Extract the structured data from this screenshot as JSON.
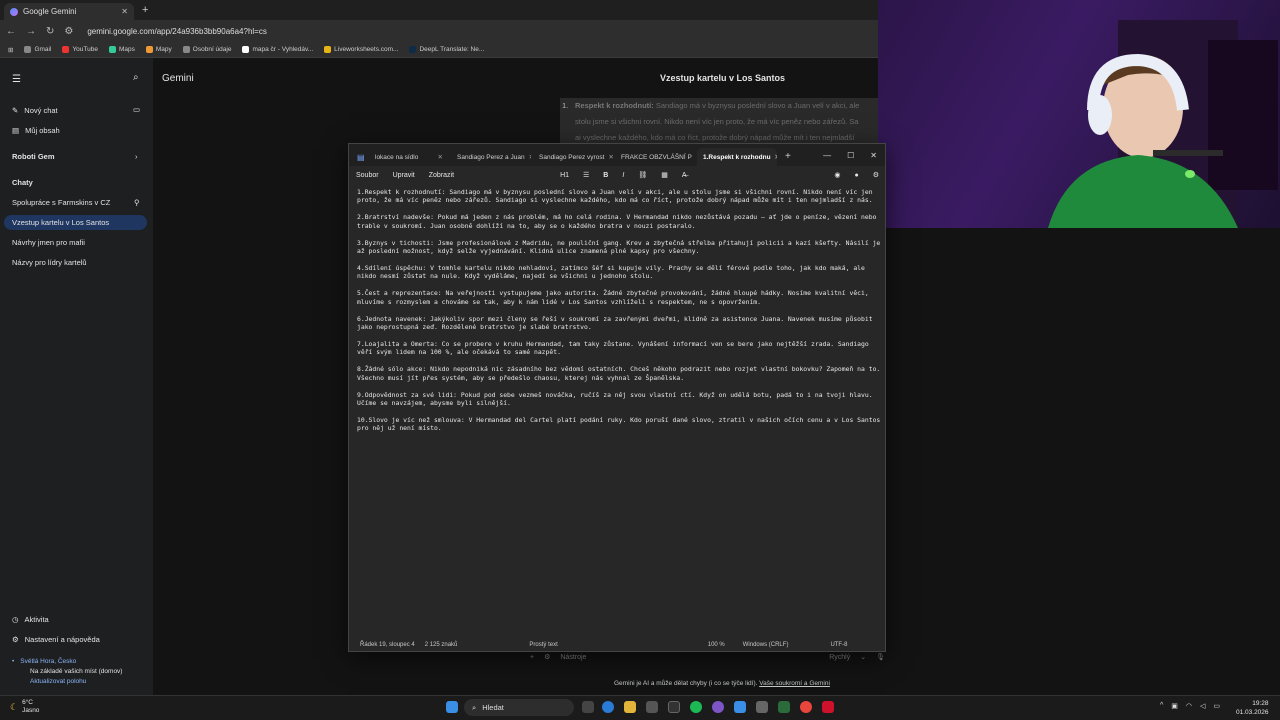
{
  "browser": {
    "tab_title": "Google Gemini",
    "tab_close": "✕",
    "new_tab": "+",
    "url": "gemini.google.com/app/24a936b3bb90a6a4?hl=cs",
    "bookmarks": [
      "Gmail",
      "YouTube",
      "Maps",
      "Mapy",
      "Osobní údaje",
      "mapa čr - Vyhledáv...",
      "Liveworksheets.com...",
      "DeepL Translate: Ne..."
    ]
  },
  "gemini": {
    "logo": "Gemini",
    "new_chat": "Nový chat",
    "my_content": "Můj obsah",
    "robots": "Roboti Gem",
    "chats_heading": "Chaty",
    "chats": [
      "Spolupráce s Farmskins v CZ",
      "Vzestup kartelu v Los Santos",
      "Návrhy jmen pro mafii",
      "Názvy pro lídry kartelů"
    ],
    "activity": "Aktivita",
    "settings": "Nastavení a nápověda",
    "location_name": "Světlá Hora, Česko",
    "location_basis": "Na základě vašich míst (domov)",
    "update_location": "Aktualizovat polohu",
    "main_title": "Vzestup kartelu v Los Santos",
    "answer_number": "1.",
    "answer_bold": "Respekt k rozhodnutí:",
    "answer_lines": [
      " Sandiago má v byznysu poslední slovo a Juan velí v akci, ale",
      "stolu jsme si všichni rovní. Nikdo není víc jen proto, že má víc peněz nebo zářezů. Sa",
      "ai vyslechne každého, kdo má co říct, protože dobrý nápad může mít i ten nejmladší"
    ],
    "tools_label": "Nástroje",
    "speed_label": "Rychlý",
    "footer_text": "Gemini je AI a může dělat chyby (i co se týče lidí). ",
    "footer_link": "Vaše soukromí a Gemini"
  },
  "notepad": {
    "tabs": [
      "lokace na sídlo",
      "Sandiago Perez a Juan",
      "Sandiago Perez vyrost",
      "FRAKCE OBZVLÁŠNÍ P",
      "1.Respekt k rozhodnu"
    ],
    "active_tab_index": 4,
    "menu": [
      "Soubor",
      "Upravit",
      "Zobrazit"
    ],
    "heading_select": "H1",
    "window_controls": [
      "—",
      "☐",
      "✕"
    ],
    "paragraphs": [
      "1.Respekt k rozhodnutí: Sandiago má v byznysu poslední slovo a Juan velí v akci, ale u stolu jsme si všichni rovní. Nikdo není víc jen proto, že má víc peněz nebo zářezů. Sandiago si vyslechne každého, kdo má co říct, protože dobrý nápad může mít i ten nejmladší z nás.",
      "2.Bratrství nadevše: Pokud má jeden z nás problém, má ho celá rodina. V Hermandad nikdo nezůstává pozadu – ať jde o peníze, vězení nebo trable v soukromí. Juan osobně dohlíží na to, aby se o každého bratra v nouzi postaralo.",
      "3.Byznys v tichosti: Jsme profesionálové z Madridu, ne pouliční gang. Krev a zbytečná střelba přitahují policii a kazí kšefty. Násilí je až poslední možnost, když selže vyjednávání. Klidná ulice znamená plné kapsy pro všechny.",
      "4.Sdílení úspěchu: V tomhle kartelu nikdo nehladoví, zatímco šéf si kupuje vily. Prachy se dělí férově podle toho, jak kdo maká, ale nikdo nesmí zůstat na nule. Když vyděláme, najedí se všichni u jednoho stolu.",
      "5.Čest a reprezentace: Na veřejnosti vystupujeme jako autorita. Žádné zbytečné provokování, žádné hloupé hádky. Nosíme kvalitní věci, mluvíme s rozmyslem a chováme se tak, aby k nám lidé v Los Santos vzhlíželi s respektem, ne s opovržením.",
      "6.Jednota navenek: Jakýkoliv spor mezi členy se řeší v soukromí za zavřenými dveřmi, klidně za asistence Juana. Navenek musíme působit jako neprostupná zeď. Rozdělené bratrstvo je slabé bratrstvo.",
      "7.Loajalita a Omerta: Co se probere v kruhu Hermandad, tam taky zůstane. Vynášení informací ven se bere jako nejtěžší zrada. Sandiago věří svým lidem na 100 %, ale očekává to samé nazpět.",
      "8.Žádné sólo akce: Nikdo nepodniká nic zásadního bez vědomí ostatních. Chceš někoho podrazit nebo rozjet vlastní bokovku? Zapomeň na to. Všechno musí jít přes systém, aby se předešlo chaosu, kterej nás vyhnal ze Španělska.",
      "9.Odpovědnost za své lidi: Pokud pod sebe vezmeš nováčka, ručíš za něj svou vlastní ctí. Když on udělá botu, padá to i na tvoji hlavu. Učíme se navzájem, abysme byli silnější.",
      "10.Slovo je víc než smlouva: V Hermandad del Cartel platí podání ruky. Kdo poruší dané slovo, ztratil v našich očích cenu a v Los Santos pro něj už není místo."
    ],
    "status": {
      "position": "Řádek 19, sloupec 4",
      "chars": "2 125 znaků",
      "format": "Prostý text",
      "zoom": "100 %",
      "line_ending": "Windows (CRLF)",
      "encoding": "UTF-8"
    }
  },
  "taskbar": {
    "temperature": "6°C",
    "weather": "Jasno",
    "search_label": "Hledat",
    "time": "19:28",
    "date": "01.03.2026"
  },
  "colors": {
    "active_chat": "#1f3760",
    "accent": "#8ab4f8",
    "webcam_bg": "#3a1b63"
  }
}
